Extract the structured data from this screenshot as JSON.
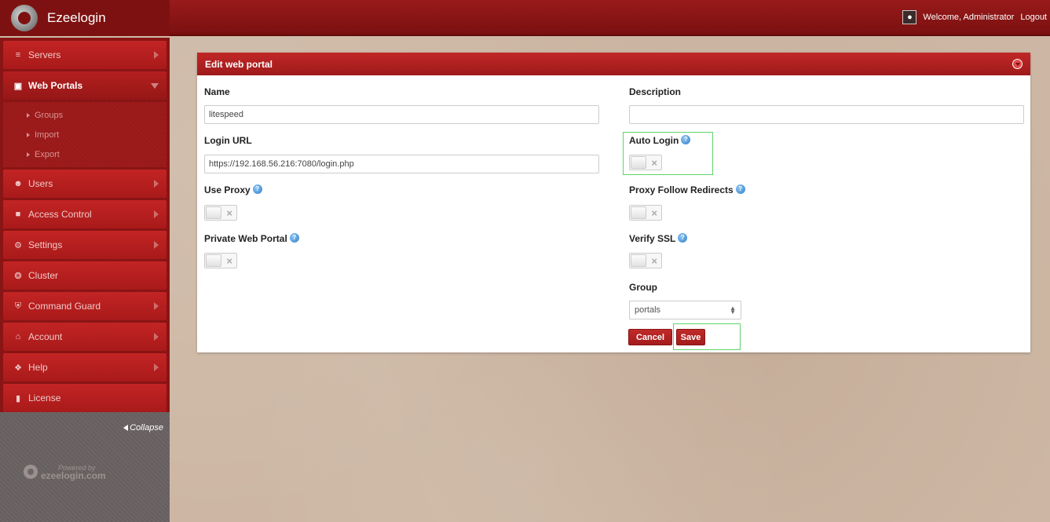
{
  "header": {
    "brand": "Ezeelogin",
    "welcome": "Welcome, Administrator",
    "logout": "Logout"
  },
  "sidebar": {
    "items": [
      {
        "label": "Servers",
        "icon": "list-icon"
      },
      {
        "label": "Web Portals",
        "icon": "layout-icon",
        "active": true
      },
      {
        "label": "Users",
        "icon": "users-icon"
      },
      {
        "label": "Access Control",
        "icon": "lock-icon"
      },
      {
        "label": "Settings",
        "icon": "gears-icon"
      },
      {
        "label": "Cluster",
        "icon": "cluster-icon"
      },
      {
        "label": "Command Guard",
        "icon": "shield-icon"
      },
      {
        "label": "Account",
        "icon": "home-icon"
      },
      {
        "label": "Help",
        "icon": "lifebuoy-icon"
      },
      {
        "label": "License",
        "icon": "document-icon"
      }
    ],
    "subitems": [
      "Groups",
      "Import",
      "Export"
    ],
    "collapse": "Collapse",
    "powered_by": "Powered by",
    "powered_domain": "ezeelogin.com"
  },
  "panel": {
    "title": "Edit web portal",
    "name_label": "Name",
    "name_value": "litespeed",
    "description_label": "Description",
    "description_value": "",
    "login_url_label": "Login URL",
    "login_url_value": "https://192.168.56.216:7080/login.php",
    "auto_login_label": "Auto Login",
    "use_proxy_label": "Use Proxy",
    "proxy_follow_label": "Proxy Follow Redirects",
    "private_label": "Private Web Portal",
    "verify_ssl_label": "Verify SSL",
    "group_label": "Group",
    "group_value": "portals",
    "cancel_label": "Cancel",
    "save_label": "Save",
    "toggle_off_symbol": "×",
    "help_symbol": "?"
  },
  "colors": {
    "brand_red": "#9a1a1a",
    "highlight": "#5fd36a",
    "help_blue": "#2f7fc9"
  }
}
